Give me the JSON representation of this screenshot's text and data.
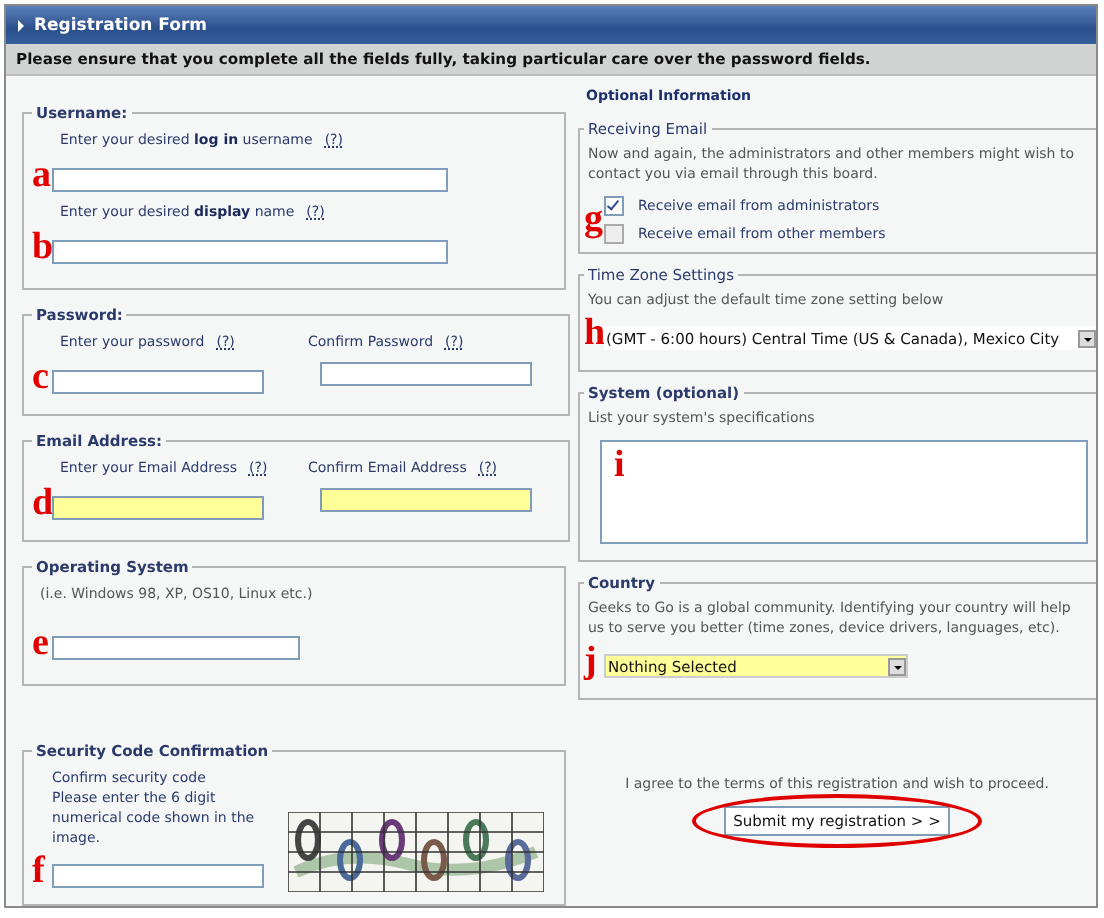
{
  "window": {
    "title": "Registration Form"
  },
  "notice": "Please ensure that you complete all the fields fully, taking particular care over the password fields.",
  "left_sections": [
    {
      "kind": "stack",
      "legend": "Username:",
      "fields": [
        {
          "label": "Enter your desired **log in** username",
          "help": "(?)",
          "marker": "a",
          "highlighted": false
        },
        {
          "label": "Enter your desired **display** name",
          "help": "(?)",
          "marker": "b",
          "highlighted": false
        }
      ]
    },
    {
      "kind": "row",
      "legend": "Password:",
      "fields": [
        {
          "label": "Enter your password",
          "help": "(?)",
          "marker": "c",
          "highlighted": false
        },
        {
          "label": "Confirm Password",
          "help": "(?)",
          "highlighted": false
        }
      ]
    },
    {
      "kind": "row",
      "legend": "Email Address:",
      "fields": [
        {
          "label": "Enter your Email Address",
          "help": "(?)",
          "marker": "d",
          "highlighted": true
        },
        {
          "label": "Confirm Email Address",
          "help": "(?)",
          "highlighted": true
        }
      ]
    },
    {
      "kind": "note",
      "legend": "Operating System",
      "description": "(i.e. Windows 98, XP, OS10, Linux etc.)",
      "fields": [
        {
          "marker": "e",
          "highlighted": false
        }
      ]
    },
    {
      "kind": "captcha",
      "legend": "Security Code Confirmation",
      "description": "Confirm security code\nPlease enter the 6 digit numerical code shown in the image.",
      "fields": [
        {
          "marker": "f",
          "highlighted": false
        }
      ]
    }
  ],
  "optional": {
    "heading": "Optional Information",
    "sections": [
      {
        "kind": "checkboxes",
        "legend": "Receiving Email",
        "legend_bold": false,
        "description": "Now and again, the administrators and other members might wish to contact you via email through this board.",
        "marker": "g",
        "options": [
          {
            "label": "Receive email from administrators",
            "checked": true
          },
          {
            "label": "Receive email from other members",
            "checked": false
          }
        ]
      },
      {
        "kind": "wide-select",
        "legend": "Time Zone Settings",
        "legend_bold": false,
        "description": "You can adjust the default time zone setting below",
        "marker": "h",
        "value": "(GMT - 6:00 hours) Central Time (US & Canada), Mexico City",
        "highlighted": false
      },
      {
        "kind": "textarea",
        "legend": "System (optional)",
        "legend_bold": true,
        "description": "List your system's specifications",
        "marker": "i"
      },
      {
        "kind": "select",
        "legend": "Country",
        "legend_bold": true,
        "description": "Geeks to Go is a global community. Identifying your country will help us to serve you better (time zones, device drivers, languages, etc).",
        "marker": "j",
        "value": "Nothing Selected",
        "highlighted": true
      }
    ]
  },
  "footer": {
    "terms": "I agree to the terms of this registration and wish to proceed.",
    "submit": "Submit my registration > >",
    "submit_circled": true
  }
}
